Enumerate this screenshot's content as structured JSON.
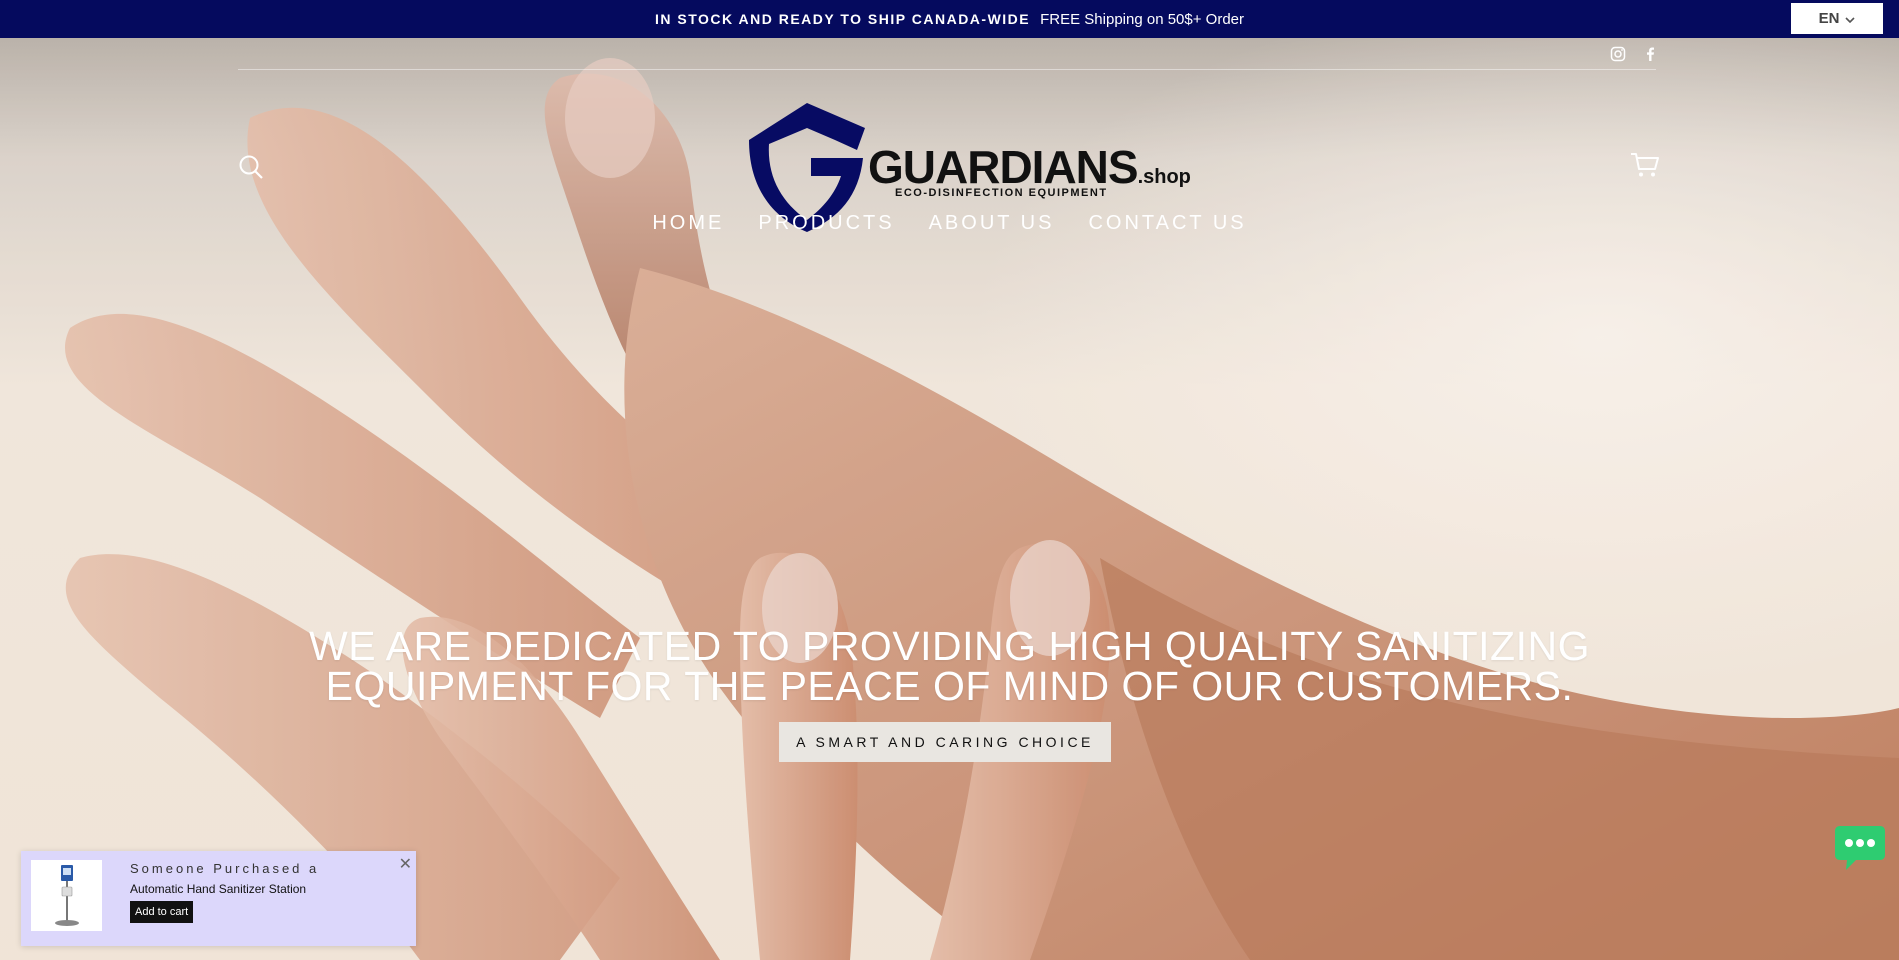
{
  "announcement": {
    "bold_text": "IN STOCK AND READY TO SHIP CANADA-WIDE",
    "text": "FREE Shipping on 50$+ Order"
  },
  "language": {
    "selected": "EN",
    "icon": "chevron-down-icon"
  },
  "social": {
    "icons": [
      "instagram-icon",
      "facebook-icon"
    ]
  },
  "header": {
    "search_icon": "search-icon",
    "cart_icon": "cart-icon",
    "logo": {
      "word": "GUARDIANS",
      "suffix": ".shop",
      "tagline": "ECO-DISINFECTION EQUIPMENT"
    }
  },
  "nav": {
    "items": [
      {
        "label": "HOME"
      },
      {
        "label": "PRODUCTS"
      },
      {
        "label": "ABOUT US"
      },
      {
        "label": "CONTACT US"
      }
    ]
  },
  "hero": {
    "line1": "WE ARE DEDICATED TO PROVIDING HIGH QUALITY SANITIZING",
    "line2": "EQUIPMENT FOR THE PEACE OF MIND OF OUR CUSTOMERS.",
    "cta_label": "A SMART AND CARING CHOICE"
  },
  "popup": {
    "line1": "Someone Purchased a",
    "product": "Automatic Hand Sanitizer Station",
    "button": "Add to cart",
    "close": "✕"
  },
  "colors": {
    "announcement_bg": "#050a5e",
    "logo_shield": "#070b63",
    "popup_bg": "#dcd7fb",
    "chat_green": "#2ecc71"
  }
}
